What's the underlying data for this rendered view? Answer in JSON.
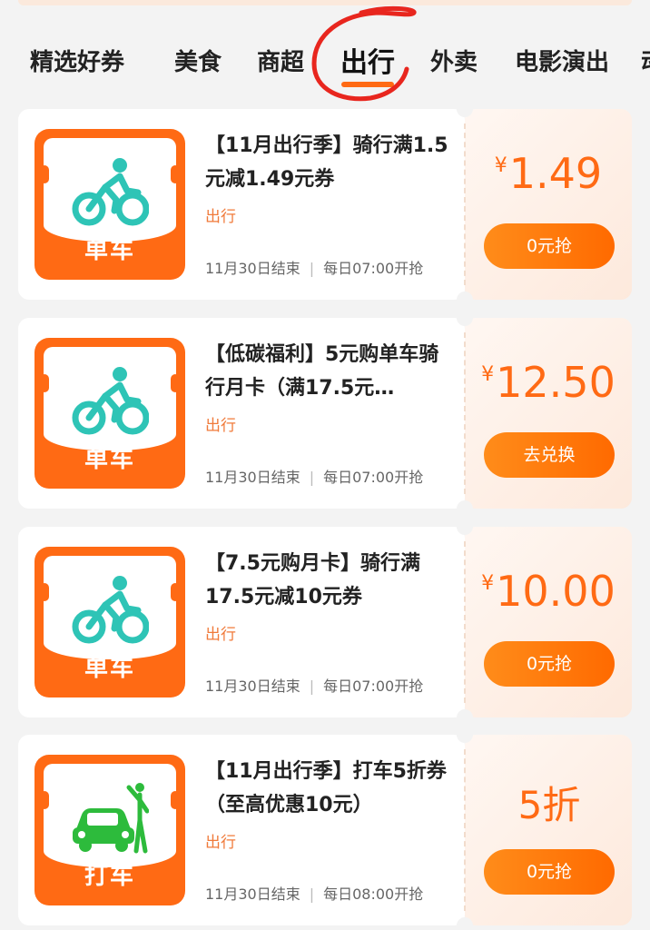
{
  "tabs": [
    {
      "label": "精选好券",
      "active": false
    },
    {
      "label": "美食",
      "active": false
    },
    {
      "label": "商超",
      "active": false
    },
    {
      "label": "出行",
      "active": true
    },
    {
      "label": "外卖",
      "active": false
    },
    {
      "label": "电影演出",
      "active": false
    },
    {
      "label": "动",
      "active": false
    }
  ],
  "colors": {
    "accent": "#ff6a14",
    "category": "#f07a3a",
    "bike_icon": "#2ec4b6",
    "taxi_icon": "#2dbb3c"
  },
  "coupons": [
    {
      "icon": "bicycle-icon",
      "icon_label": "单车",
      "title": "【11月出行季】骑行满1.5元减1.49元券",
      "category": "出行",
      "end_date": "11月30日结束",
      "daily": "每日07:00开抢",
      "price_currency": "¥",
      "price_value": "1.49",
      "button": "0元抢"
    },
    {
      "icon": "bicycle-icon",
      "icon_label": "单车",
      "title": "【低碳福利】5元购单车骑行月卡（满17.5元…",
      "category": "出行",
      "end_date": "11月30日结束",
      "daily": "每日07:00开抢",
      "price_currency": "¥",
      "price_value": "12.50",
      "button": "去兑换"
    },
    {
      "icon": "bicycle-icon",
      "icon_label": "单车",
      "title": "【7.5元购月卡】骑行满17.5元减10元券",
      "category": "出行",
      "end_date": "11月30日结束",
      "daily": "每日07:00开抢",
      "price_currency": "¥",
      "price_value": "10.00",
      "button": "0元抢"
    },
    {
      "icon": "taxi-icon",
      "icon_label": "打车",
      "title": "【11月出行季】打车5折券（至高优惠10元）",
      "category": "出行",
      "end_date": "11月30日结束",
      "daily": "每日08:00开抢",
      "price_currency": "",
      "price_value": "5折",
      "button": "0元抢"
    }
  ]
}
